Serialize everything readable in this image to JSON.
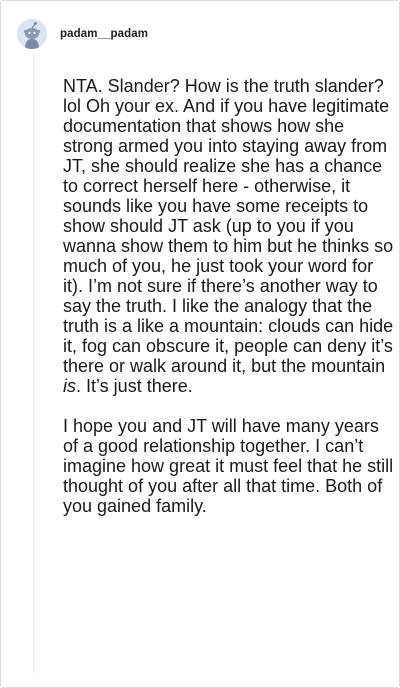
{
  "comment": {
    "username": "padam__padam",
    "avatar_icon": "snoo-avatar",
    "paragraph1": {
      "before_emphasis": "NTA. Slander? How is the truth slander? lol Oh your ex. And if you have legitimate documentation that shows how she strong armed you into staying away from JT, she should realize she has a chance to correct herself here - otherwise, it sounds like you have some receipts to show should JT ask (up to you if you wanna show them to him but he thinks so much of you, he just took your word for it). I’m not sure if there’s another way to say the truth. I like the analogy that the truth is a like a mountain: clouds can hide it, fog can obscure it, people can deny it’s there or walk around it, but the mountain ",
      "emphasis": "is",
      "after_emphasis": ". It’s just there."
    },
    "paragraph2": "I hope you and JT will have many years of a good relationship together. I can’t imagine how great it must feel that he still thought of you after all that time. Both of you gained family."
  }
}
